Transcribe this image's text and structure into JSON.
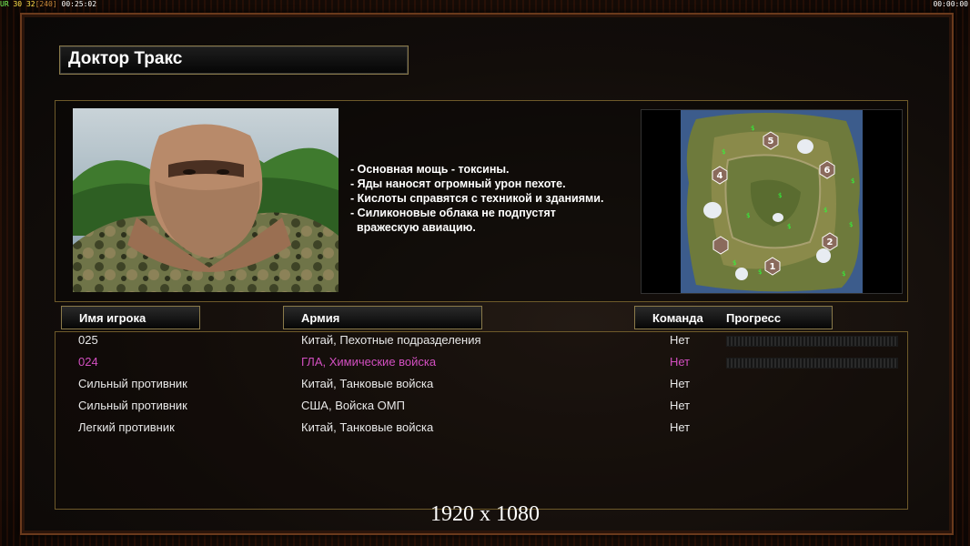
{
  "overlay": {
    "stats": [
      "UR",
      "30",
      "32",
      "[240]",
      "00:25:02"
    ],
    "clock": "00:00:00",
    "resolution": "1920 x 1080"
  },
  "general": {
    "name": "Доктор Тракс",
    "description": [
      "- Основная мощь - токсины.",
      "- Яды наносят огромный урон пехоте.",
      "- Кислоты справятся с техникой и зданиями.",
      "- Силиконовые облака не подпустят",
      "  вражескую авиацию."
    ]
  },
  "minimap": {
    "start_positions": [
      "1",
      "2",
      "4",
      "5",
      "6"
    ]
  },
  "table": {
    "headers": {
      "player": "Имя игрока",
      "army": "Армия",
      "team": "Команда",
      "progress": "Прогресс"
    },
    "rows": [
      {
        "player": "025",
        "army": "Китай, Пехотные подразделения",
        "team": "Нет",
        "color": "#e8e8e8",
        "progress": 0
      },
      {
        "player": "024",
        "army": "ГЛА, Химические войска",
        "team": "Нет",
        "color": "#d24fc0",
        "progress": 0
      },
      {
        "player": "Сильный противник",
        "army": "Китай, Танковые войска",
        "team": "Нет",
        "color": "#e8e8e8"
      },
      {
        "player": "Сильный противник",
        "army": "США, Войска ОМП",
        "team": "Нет",
        "color": "#e8e8e8"
      },
      {
        "player": "Легкий противник",
        "army": "Китай, Танковые войска",
        "team": "Нет",
        "color": "#e8e8e8"
      }
    ]
  }
}
